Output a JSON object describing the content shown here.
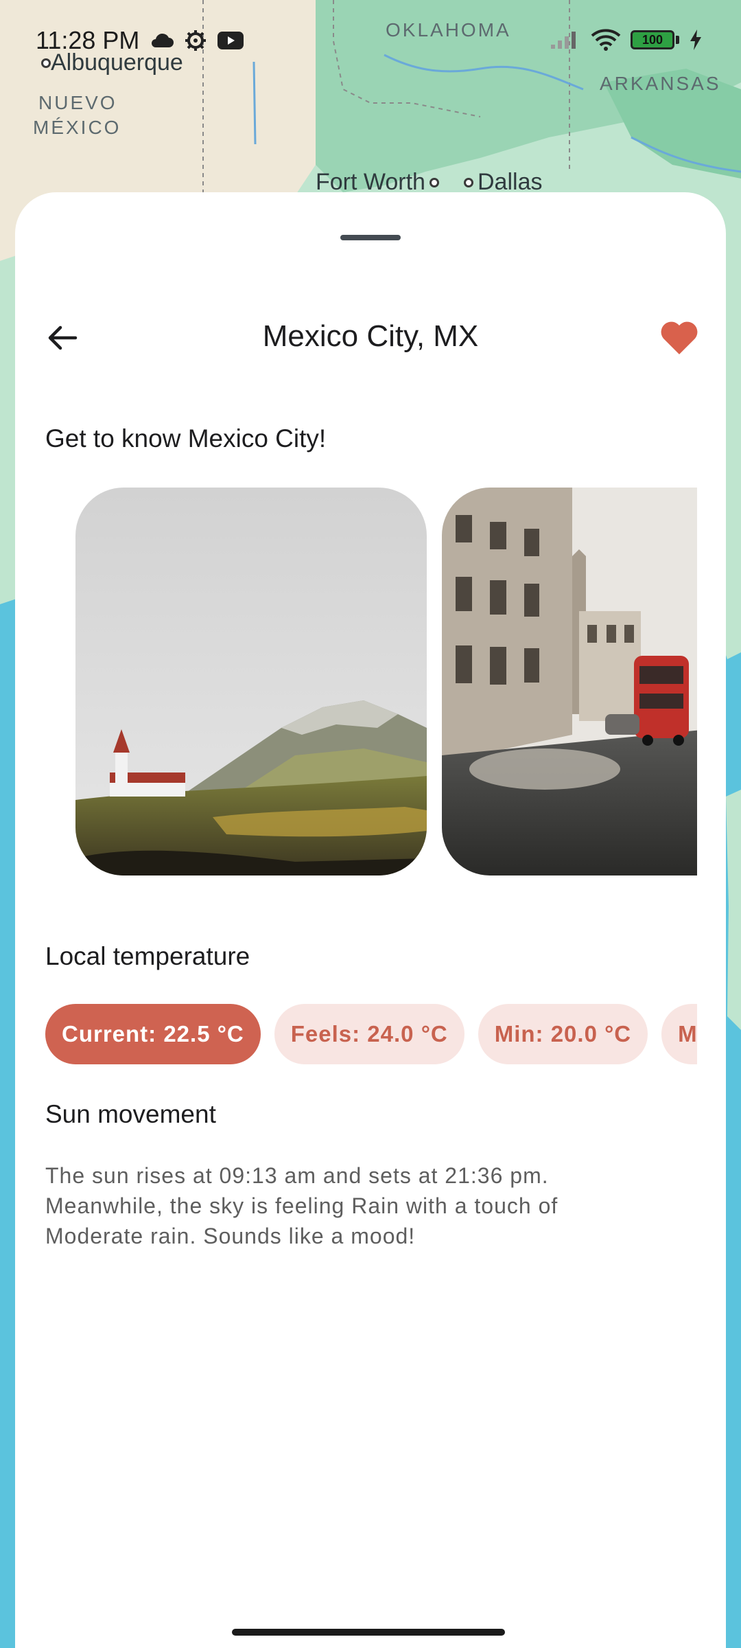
{
  "status_bar": {
    "time": "11:28 PM",
    "battery": "100"
  },
  "map": {
    "labels": {
      "oklahoma": "OKLAHOMA",
      "arkansas": "ARKANSAS",
      "nuevo": "NUEVO",
      "mexico": "MÉXICO"
    },
    "cities": {
      "albuquerque": "Albuquerque",
      "fort_worth": "Fort Worth",
      "dallas": "Dallas"
    }
  },
  "header": {
    "title": "Mexico City, MX"
  },
  "gallery": {
    "title": "Get to know Mexico City!"
  },
  "temperature": {
    "title": "Local temperature",
    "chips": [
      "Current: 22.5 °C",
      "Feels: 24.0 °C",
      "Min: 20.0 °C",
      "Ma"
    ]
  },
  "sun": {
    "title": "Sun movement",
    "description": "The sun rises at 09:13 am and sets at 21:36 pm. Meanwhile, the sky is feeling Rain with a touch of Moderate rain. Sounds like a mood!"
  },
  "colors": {
    "accent": "#cf6351",
    "chip_inactive_bg": "#f8e5e2",
    "favorite": "#d9614c"
  }
}
